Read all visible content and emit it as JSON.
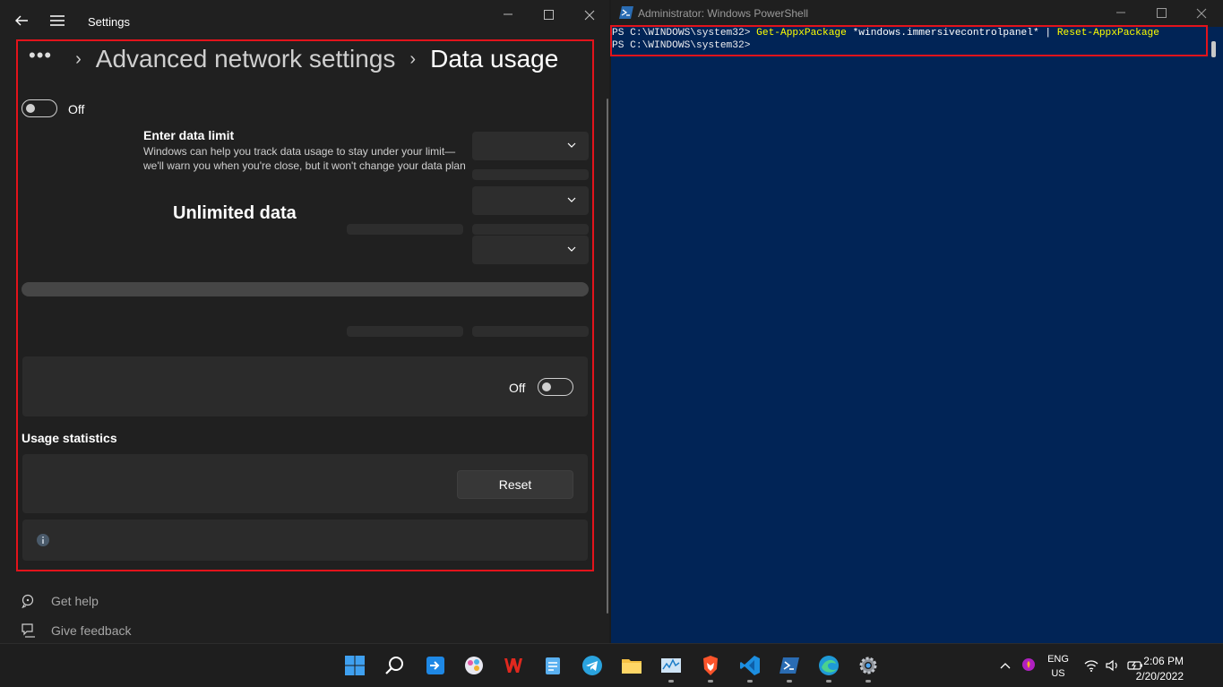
{
  "settings": {
    "title": "Settings",
    "breadcrumb": {
      "overflow": "•••",
      "parent": "Advanced network settings",
      "current": "Data usage"
    },
    "limit_toggle_label": "Off",
    "limit": {
      "title": "Enter data limit",
      "description": "Windows can help you track data usage to stay under your limit—we'll warn you when you're close, but it won't change your data plan"
    },
    "plan_label": "Unlimited data",
    "background_toggle_label": "Off",
    "usage_title": "Usage statistics",
    "reset_label": "Reset",
    "footer": {
      "help": "Get help",
      "feedback": "Give feedback"
    }
  },
  "powershell": {
    "title": "Administrator: Windows PowerShell",
    "line1": {
      "prompt": "PS C:\\WINDOWS\\system32> ",
      "cmd1": "Get-AppxPackage",
      "arg": " *windows.immersivecontrolpanel* | ",
      "cmd2": "Reset-AppxPackage"
    },
    "line2": {
      "prompt": "PS C:\\WINDOWS\\system32>"
    }
  },
  "taskbar": {
    "language": "ENG",
    "region": "US",
    "time": "2:06 PM",
    "date": "2/20/2022"
  },
  "colors": {
    "accent_red": "#e3131b",
    "ps_background": "#012456",
    "ps_command": "#ffff00"
  }
}
